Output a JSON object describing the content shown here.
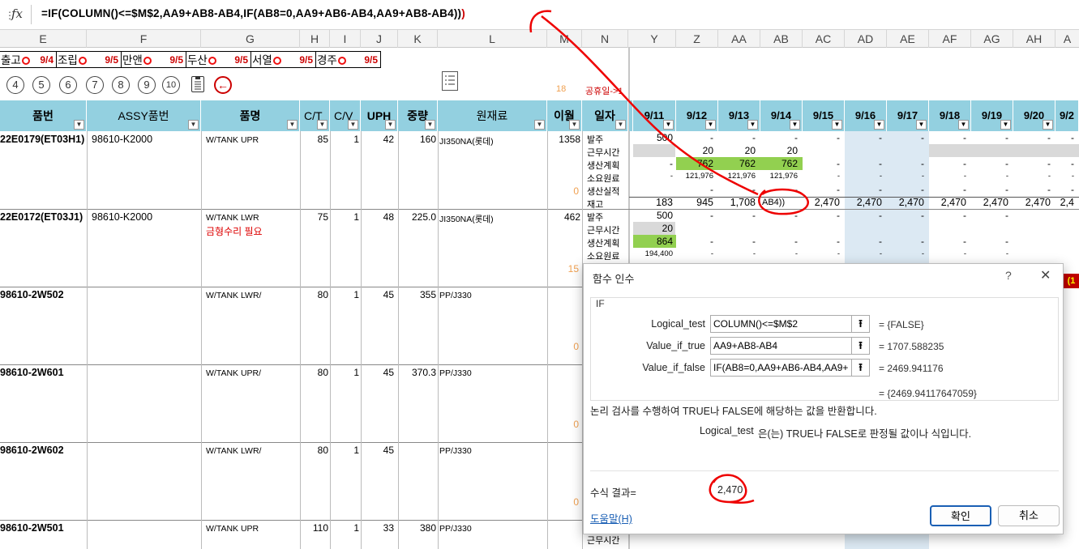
{
  "formula_bar": {
    "fx": "fx",
    "formula": "=IF(COLUMN()<=$M$2,AA9+AB8-AB4,IF(AB8=0,AA9+AB6-AB4,AA9+AB8-AB4))",
    "tail": ")"
  },
  "columns": [
    "E",
    "F",
    "G",
    "H",
    "I",
    "J",
    "K",
    "L",
    "M",
    "N",
    "Y",
    "Z",
    "AA",
    "AB",
    "AC",
    "AD",
    "AE",
    "AF",
    "AG",
    "AH",
    "A"
  ],
  "row1": [
    {
      "label": "출고",
      "date": "9/4"
    },
    {
      "label": "조립",
      "date": "9/5"
    },
    {
      "label": "만앤",
      "date": "9/5"
    },
    {
      "label": "두산",
      "date": "9/5"
    },
    {
      "label": "서열",
      "date": "9/5"
    },
    {
      "label": "경주",
      "date": "9/5"
    }
  ],
  "row2": {
    "numbers": [
      "4",
      "5",
      "6",
      "7",
      "8",
      "9",
      "10"
    ],
    "back": "←",
    "m_value": "18",
    "n_value": "공휴일->1"
  },
  "headers": {
    "part_no": "품번",
    "assy": "ASSY품번",
    "name": "품명",
    "ct": "C/T",
    "cv": "C/V",
    "uph": "UPH",
    "weight": "중량",
    "material": "원재료",
    "carry": "이월",
    "type": "일자",
    "dates": [
      "9/11",
      "9/12",
      "9/13",
      "9/14",
      "9/15",
      "9/16",
      "9/17",
      "9/18",
      "9/19",
      "9/20",
      "9/2"
    ]
  },
  "row_labels": [
    "발주",
    "근무시간",
    "생산계획",
    "소요원료",
    "생산실적",
    "재고"
  ],
  "rows": [
    {
      "part": "22E0179(ET03H1)",
      "assy": "98610-K2000",
      "name": "W/TANK UPR",
      "note": "",
      "ct": "85",
      "cv": "1",
      "uph": "42",
      "weight": "160",
      "material": "JI350NA(롯데)",
      "carry": "1358",
      "m_small": "0"
    },
    {
      "part": "22E0172(ET03J1)",
      "assy": "98610-K2000",
      "name": "W/TANK LWR",
      "note": "금형수리 필요",
      "ct": "75",
      "cv": "1",
      "uph": "48",
      "weight": "225.0",
      "material": "JI350NA(롯데)",
      "carry": "462",
      "m_small": "15"
    },
    {
      "part": "98610-2W502",
      "assy": "",
      "name": "W/TANK LWR/",
      "note": "",
      "ct": "80",
      "cv": "1",
      "uph": "45",
      "weight": "355",
      "material": "PP/J330",
      "carry": "",
      "m_small": "0"
    },
    {
      "part": "98610-2W601",
      "assy": "",
      "name": "W/TANK UPR/",
      "note": "",
      "ct": "80",
      "cv": "1",
      "uph": "45",
      "weight": "370.3",
      "material": "PP/J330",
      "carry": "",
      "m_small": "0"
    },
    {
      "part": "98610-2W602",
      "assy": "",
      "name": "W/TANK LWR/",
      "note": "",
      "ct": "80",
      "cv": "1",
      "uph": "45",
      "weight": "",
      "material": "PP/J330",
      "carry": "",
      "m_small": "0"
    },
    {
      "part": "98610-2W501",
      "assy": "",
      "name": "W/TANK UPR",
      "note": "",
      "ct": "110",
      "cv": "1",
      "uph": "33",
      "weight": "380",
      "material": "PP/J330",
      "carry": "",
      "m_small": ""
    }
  ],
  "r1_grid": {
    "order": [
      "500",
      "-",
      "-",
      "-",
      "-",
      "-",
      "-",
      "-",
      "-",
      "-",
      "-"
    ],
    "hours": [
      "",
      "20",
      "20",
      "20",
      "",
      "",
      "",
      "",
      "",
      "",
      ""
    ],
    "plan": [
      "-",
      "762",
      "762",
      "762",
      "-",
      "-",
      "-",
      "-",
      "-",
      "-",
      "-"
    ],
    "material": [
      "-",
      "121,976",
      "121,976",
      "121,976",
      "-",
      "-",
      "-",
      "-",
      "-",
      "-",
      "-"
    ],
    "result": [
      "",
      "-",
      "-",
      "-",
      "-",
      "-",
      "-",
      "-",
      "-",
      "-",
      "-"
    ],
    "stock": [
      "183",
      "945",
      "1,708",
      "AB4))",
      "2,470",
      "2,470",
      "2,470",
      "2,470",
      "2,470",
      "2,470",
      "2,4"
    ]
  },
  "r2_grid": {
    "order": [
      "500",
      "-",
      "-",
      "-",
      "-",
      "-",
      "-",
      "-",
      "-",
      "-",
      "-"
    ],
    "hours": [
      "20",
      "",
      "",
      "",
      "",
      "",
      "",
      "",
      "",
      "",
      ""
    ],
    "plan": [
      "864",
      "-",
      "-",
      "-",
      "-",
      "-",
      "-",
      "-",
      "-",
      "-",
      "-"
    ],
    "material": [
      "194,400",
      "-",
      "-",
      "-",
      "-",
      "-",
      "-",
      "-",
      "-",
      "-",
      "-"
    ]
  },
  "last_row_label": "근무시간",
  "dialog": {
    "title": "함수 인수",
    "help_q": "?",
    "close": "✕",
    "func": "IF",
    "args": [
      {
        "label": "Logical_test",
        "input": "COLUMN()<=$M$2",
        "value": "= {FALSE}"
      },
      {
        "label": "Value_if_true",
        "input": "AA9+AB8-AB4",
        "value": "= 1707.588235"
      },
      {
        "label": "Value_if_false",
        "input": "IF(AB8=0,AA9+AB6-AB4,AA9+",
        "value": "= 2469.941176"
      }
    ],
    "result_line": "= {2469.94117647059}",
    "description": "논리 검사를 수행하여 TRUE나 FALSE에 해당하는 값을 반환합니다.",
    "arg_desc_label": "Logical_test",
    "arg_desc": "은(는) TRUE나 FALSE로 판정될 값이나 식입니다.",
    "formula_result_label": "수식 결과=",
    "formula_result": "2,470",
    "help_link": "도움말(H)",
    "ok": "확인",
    "cancel": "취소"
  },
  "colors": {
    "header_bg": "#93d0e0",
    "highlight_col": "#dce9f3",
    "green": "#92d050",
    "annotation": "#e00000"
  }
}
